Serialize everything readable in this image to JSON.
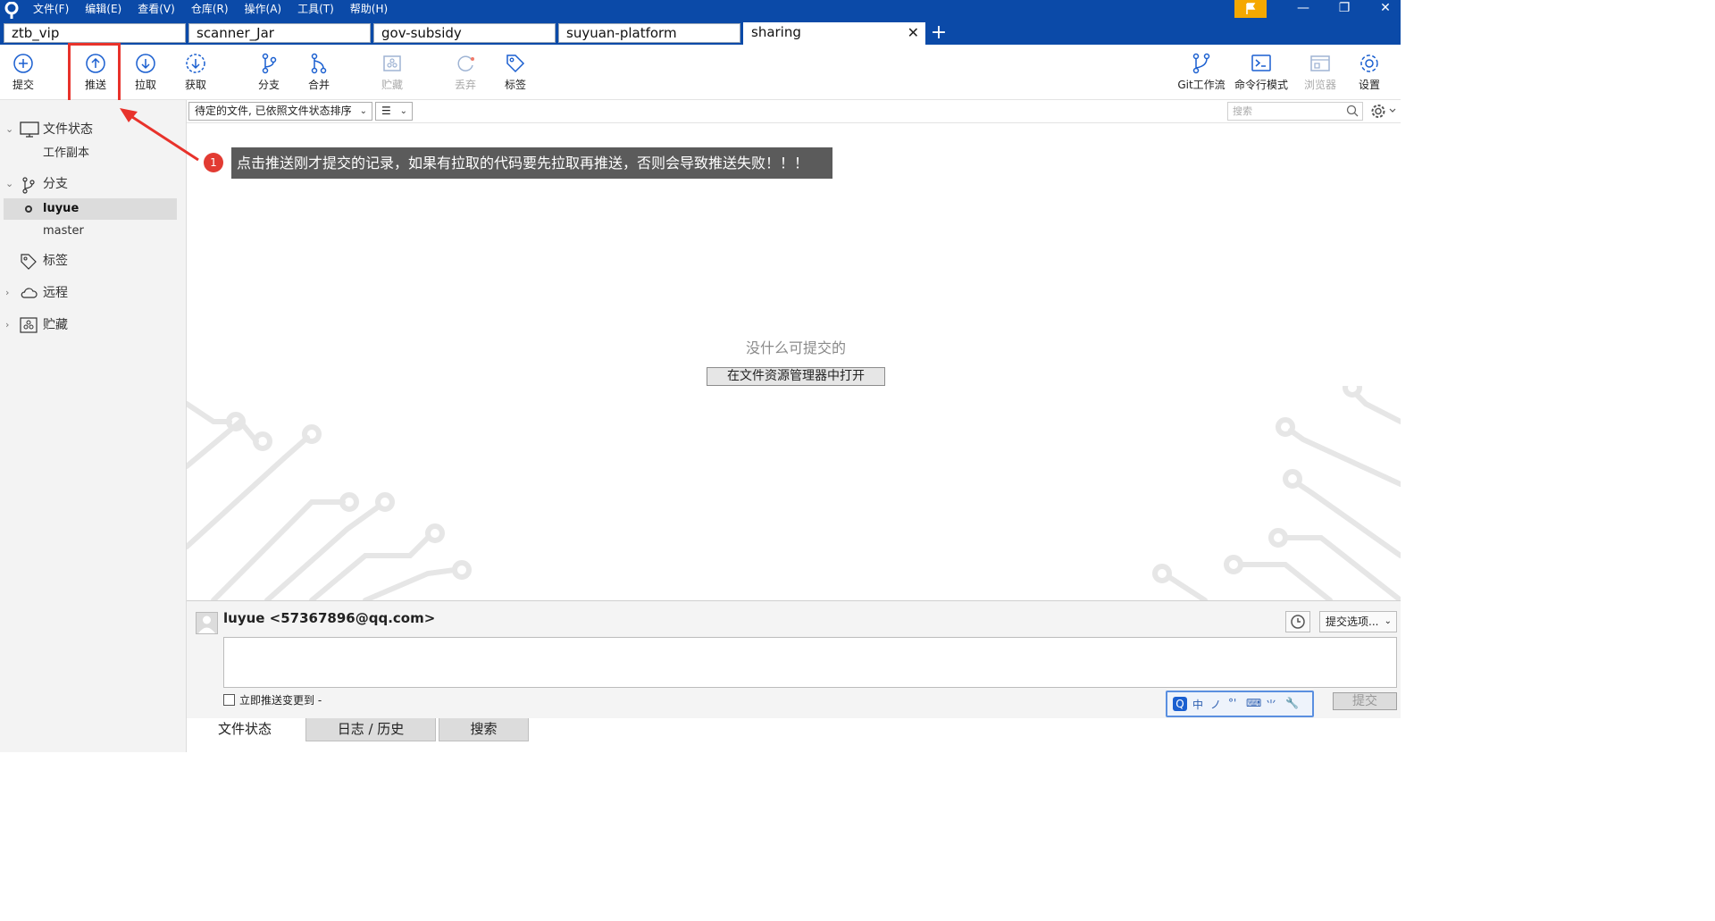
{
  "menu": [
    "文件(F)",
    "编辑(E)",
    "查看(V)",
    "仓库(R)",
    "操作(A)",
    "工具(T)",
    "帮助(H)"
  ],
  "tabs": [
    {
      "label": "ztb_vip"
    },
    {
      "label": "scanner_Jar"
    },
    {
      "label": "gov-subsidy"
    },
    {
      "label": "suyuan-platform"
    },
    {
      "label": "sharing"
    }
  ],
  "toolbar": {
    "commit": "提交",
    "push": "推送",
    "pull": "拉取",
    "fetch": "获取",
    "branch": "分支",
    "merge": "合并",
    "stash": "贮藏",
    "discard": "丢弃",
    "tag": "标签",
    "git_flow": "Git工作流",
    "terminal": "命令行模式",
    "browser": "浏览器",
    "settings": "设置"
  },
  "sidebar": {
    "file_status": "文件状态",
    "working_copy": "工作副本",
    "branches": "分支",
    "branch_items": [
      "luyue",
      "master"
    ],
    "tags": "标签",
    "remotes": "远程",
    "stashes": "贮藏"
  },
  "filter": {
    "sort_label": "待定的文件, 已依照文件状态排序",
    "search_placeholder": "搜索"
  },
  "main": {
    "empty_text": "没什么可提交的",
    "open_explorer": "在文件资源管理器中打开"
  },
  "annotation": {
    "badge": "1",
    "text": "点击推送刚才提交的记录，如果有拉取的代码要先拉取再推送，否则会导致推送失败！！！",
    "color": "#e8322b"
  },
  "commit_panel": {
    "author": "luyue <57367896@qq.com>",
    "options": "提交选项...",
    "push_immediately": "立即推送变更到 -",
    "commit_button": "提交",
    "ime": [
      "中",
      "ノ",
      "°'",
      "⌨",
      "⺌",
      "🔧"
    ]
  },
  "bottom_tabs": [
    "文件状态",
    "日志 / 历史",
    "搜索"
  ],
  "colors": {
    "titlebar": "#0b4aa8",
    "accent": "#1a5fd0",
    "flag": "#f5a800"
  }
}
